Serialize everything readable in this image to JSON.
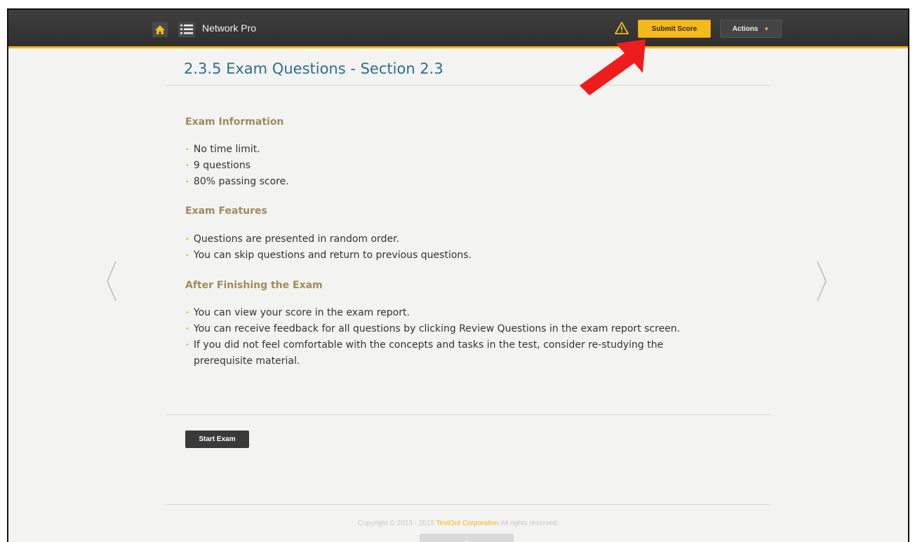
{
  "header": {
    "app_title": "Network Pro",
    "submit_label": "Submit Score",
    "actions_label": "Actions",
    "icons": [
      "home-icon",
      "list-icon",
      "warning-icon",
      "caret-down-icon"
    ],
    "accent_color": "#f5b91d"
  },
  "main": {
    "title": "2.3.5 Exam Questions - Section 2.3",
    "sections": [
      {
        "heading": "Exam Information",
        "items": [
          "No time limit.",
          "9 questions",
          "80% passing score."
        ]
      },
      {
        "heading": "Exam Features",
        "items": [
          "Questions are presented in random order.",
          "You can skip questions and return to previous questions."
        ]
      },
      {
        "heading": "After Finishing the Exam",
        "items": [
          "You can view your score in the exam report.",
          "You can receive feedback for all questions by clicking Review Questions in the exam report screen.",
          "If you did not feel comfortable with the concepts and tasks in the test, consider re-studying the",
          "prerequisite material."
        ]
      }
    ],
    "start_label": "Start Exam"
  },
  "footer": {
    "prefix": "Copyright © 2013 - 2015",
    "brand": "TestOut Corporation",
    "suffix": "All rights reserved."
  }
}
